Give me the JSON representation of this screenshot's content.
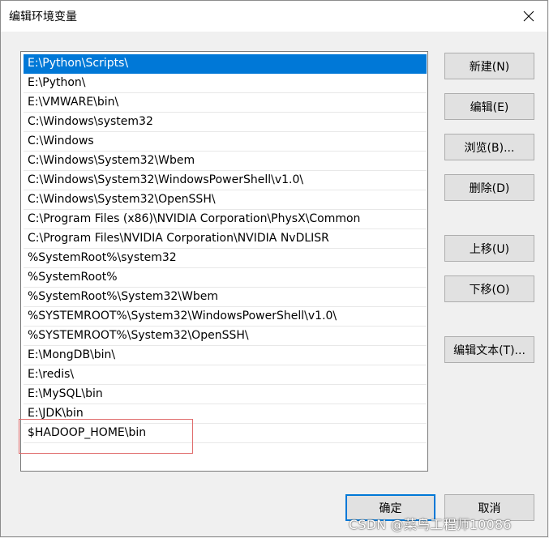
{
  "window": {
    "title": "编辑环境变量"
  },
  "path_list": [
    "E:\\Python\\Scripts\\",
    "E:\\Python\\",
    "E:\\VMWARE\\bin\\",
    "C:\\Windows\\system32",
    "C:\\Windows",
    "C:\\Windows\\System32\\Wbem",
    "C:\\Windows\\System32\\WindowsPowerShell\\v1.0\\",
    "C:\\Windows\\System32\\OpenSSH\\",
    "C:\\Program Files (x86)\\NVIDIA Corporation\\PhysX\\Common",
    "C:\\Program Files\\NVIDIA Corporation\\NVIDIA NvDLISR",
    "%SystemRoot%\\system32",
    "%SystemRoot%",
    "%SystemRoot%\\System32\\Wbem",
    "%SYSTEMROOT%\\System32\\WindowsPowerShell\\v1.0\\",
    "%SYSTEMROOT%\\System32\\OpenSSH\\",
    "E:\\MongDB\\bin\\",
    "E:\\redis\\",
    "E:\\MySQL\\bin",
    "E:\\JDK\\bin",
    "$HADOOP_HOME\\bin"
  ],
  "buttons": {
    "new": "新建(N)",
    "edit": "编辑(E)",
    "browse": "浏览(B)...",
    "delete": "删除(D)",
    "move_up": "上移(U)",
    "move_down": "下移(O)",
    "edit_text": "编辑文本(T)...",
    "ok": "确定",
    "cancel": "取消"
  },
  "watermark": "CSDN @菜鸟工程师10086",
  "colors": {
    "selection": "#0078d7",
    "highlight_border": "#e06c6c"
  }
}
